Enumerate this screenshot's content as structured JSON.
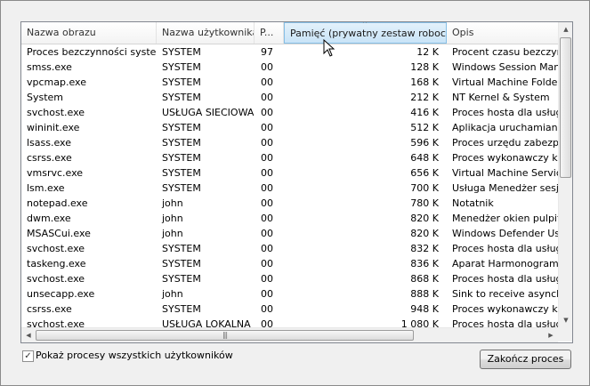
{
  "columns": {
    "name": "Nazwa obrazu",
    "user": "Nazwa użytkownika",
    "priority": "P...",
    "memory": "Pamięć (prywatny zestaw roboczy)",
    "description": "Opis"
  },
  "sort_indicator": "^",
  "rows": [
    {
      "name": "Proces bezczynności systemu",
      "user": "SYSTEM",
      "p": "97",
      "mem": "12 K",
      "desc": "Procent czasu bezczynności"
    },
    {
      "name": "smss.exe",
      "user": "SYSTEM",
      "p": "00",
      "mem": "128 K",
      "desc": "Windows Session Manager"
    },
    {
      "name": "vpcmap.exe",
      "user": "SYSTEM",
      "p": "00",
      "mem": "168 K",
      "desc": "Virtual Machine Folder Sh"
    },
    {
      "name": "System",
      "user": "SYSTEM",
      "p": "00",
      "mem": "212 K",
      "desc": "NT Kernel & System"
    },
    {
      "name": "svchost.exe",
      "user": "USŁUGA SIECIOWA",
      "p": "00",
      "mem": "416 K",
      "desc": "Proces hosta dla usług sy"
    },
    {
      "name": "wininit.exe",
      "user": "SYSTEM",
      "p": "00",
      "mem": "512 K",
      "desc": "Aplikacja uruchamiania sy"
    },
    {
      "name": "lsass.exe",
      "user": "SYSTEM",
      "p": "00",
      "mem": "596 K",
      "desc": "Proces urzędu zabezpiecz"
    },
    {
      "name": "csrss.exe",
      "user": "SYSTEM",
      "p": "00",
      "mem": "648 K",
      "desc": "Proces wykonawczy klien"
    },
    {
      "name": "vmsrvc.exe",
      "user": "SYSTEM",
      "p": "00",
      "mem": "656 K",
      "desc": "Virtual Machine Services"
    },
    {
      "name": "lsm.exe",
      "user": "SYSTEM",
      "p": "00",
      "mem": "700 K",
      "desc": "Usługa Menedżer sesji lo"
    },
    {
      "name": "notepad.exe",
      "user": "john",
      "p": "00",
      "mem": "780 K",
      "desc": "Notatnik"
    },
    {
      "name": "dwm.exe",
      "user": "john",
      "p": "00",
      "mem": "820 K",
      "desc": "Menedżer okien pulpitu"
    },
    {
      "name": "MSASCui.exe",
      "user": "john",
      "p": "00",
      "mem": "820 K",
      "desc": "Windows Defender User"
    },
    {
      "name": "svchost.exe",
      "user": "SYSTEM",
      "p": "00",
      "mem": "832 K",
      "desc": "Proces hosta dla usług sy"
    },
    {
      "name": "taskeng.exe",
      "user": "SYSTEM",
      "p": "00",
      "mem": "836 K",
      "desc": "Aparat Harmonogramu za"
    },
    {
      "name": "svchost.exe",
      "user": "SYSTEM",
      "p": "00",
      "mem": "868 K",
      "desc": "Proces hosta dla usług sy"
    },
    {
      "name": "unsecapp.exe",
      "user": "john",
      "p": "00",
      "mem": "888 K",
      "desc": "Sink to receive asynchro"
    },
    {
      "name": "csrss.exe",
      "user": "SYSTEM",
      "p": "00",
      "mem": "948 K",
      "desc": "Proces wykonawczy klien"
    },
    {
      "name": "svchost.exe",
      "user": "USŁUGA LOKALNA",
      "p": "00",
      "mem": "1 080 K",
      "desc": "Proces hosta dla usług sy"
    }
  ],
  "checkbox": {
    "label": "Pokaż procesy wszystkich użytkowników",
    "checked": true,
    "mark": "✓"
  },
  "end_process_button": "Zakończ proces",
  "scroll_glyphs": {
    "up": "▲",
    "down": "▼",
    "left": "◀",
    "right": "▶",
    "grip": "|||"
  }
}
